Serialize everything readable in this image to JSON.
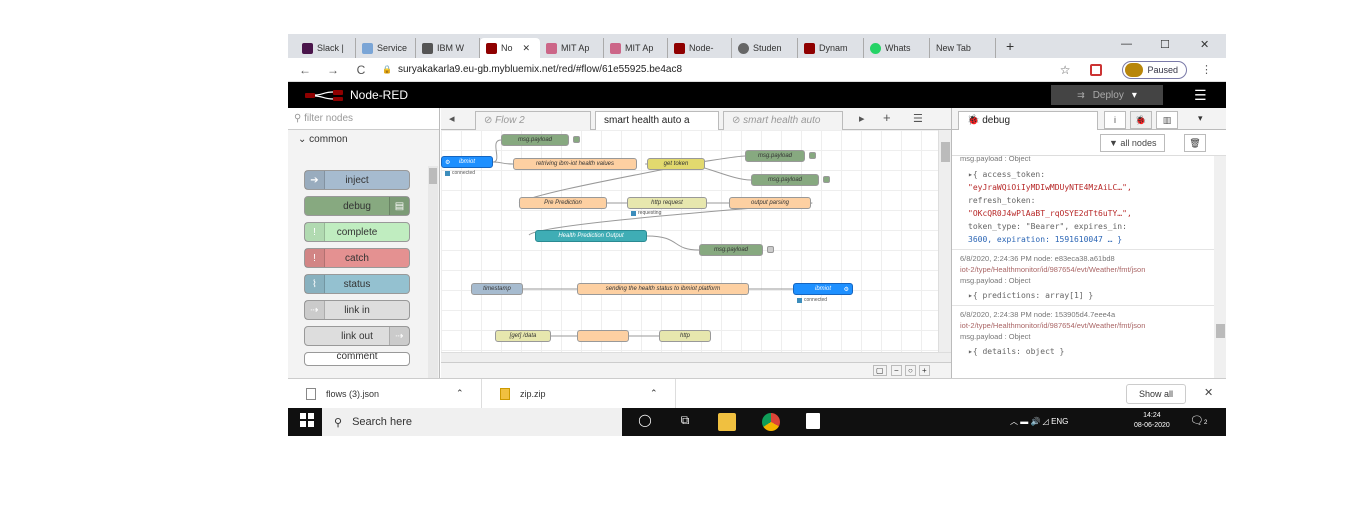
{
  "browser": {
    "tabs": [
      {
        "label": "Slack |",
        "color": "#4a154b"
      },
      {
        "label": "Service",
        "color": "#7aa5d6"
      },
      {
        "label": "IBM W",
        "color": "#555555"
      },
      {
        "label": "No",
        "color": "#8f0000",
        "active": true
      },
      {
        "label": "MIT Ap",
        "color": "#cc6688"
      },
      {
        "label": "MIT Ap",
        "color": "#cc6688"
      },
      {
        "label": "Node-",
        "color": "#8f0000"
      },
      {
        "label": "Studen",
        "color": "#666666"
      },
      {
        "label": "Dynam",
        "color": "#8f0000"
      },
      {
        "label": "Whats",
        "color": "#25d366"
      },
      {
        "label": "New Tab",
        "color": ""
      }
    ],
    "url": "suryakakarla9.eu-gb.mybluemix.net/red/#flow/61e55925.be4ac8",
    "paused_label": "Paused"
  },
  "nodered": {
    "app_title": "Node-RED",
    "deploy_label": "Deploy",
    "palette": {
      "filter_placeholder": "filter nodes",
      "category": "common",
      "nodes": [
        {
          "label": "inject",
          "color": "#a6bbcf",
          "icon": "arrow-right-icon",
          "icon_right": false
        },
        {
          "label": "debug",
          "color": "#87a980",
          "icon": "list-icon",
          "icon_right": true
        },
        {
          "label": "complete",
          "color": "#c0edc0",
          "icon": "exclamation-icon",
          "icon_right": false
        },
        {
          "label": "catch",
          "color": "#e49191",
          "icon": "exclamation-icon",
          "icon_right": false
        },
        {
          "label": "status",
          "color": "#94c1d0",
          "icon": "pulse-icon",
          "icon_right": false
        },
        {
          "label": "link in",
          "color": "#dddddd",
          "icon": "link-icon",
          "icon_right": false
        },
        {
          "label": "link out",
          "color": "#dddddd",
          "icon": "link-icon",
          "icon_right": true
        },
        {
          "label": "comment",
          "color": "#ffffff",
          "icon": "",
          "icon_right": false
        }
      ]
    },
    "workspace": {
      "tabs": [
        {
          "label": "Flow 2",
          "active": false
        },
        {
          "label": "smart health auto a",
          "active": true
        },
        {
          "label": "smart health auto",
          "active": false
        }
      ],
      "flow_nodes": {
        "msg_payload": "msg.payload",
        "retrieving": "retriving ibm-iot health values",
        "get_token": "get token",
        "pre_prediction": "Pre Prediction",
        "http_request": "http request",
        "output_parsing": "output parsing",
        "health_prediction": "Health Prediction Output",
        "timestamp": "timestamp",
        "sending": "sending the health status to ibmiot platform",
        "get_data": "[get] /data",
        "http": "http",
        "connected": "connected",
        "requesting": "requesting"
      }
    },
    "sidebar": {
      "tab_label": "debug",
      "filter_label": "all nodes",
      "messages": [
        {
          "meta": "msg.payload : Object",
          "lines": [
            "▸{ access_token:",
            "\"eyJraWQiOiIyMDIwMDUyNTE4MzAiLC…\",",
            "refresh_token:",
            "\"OKcQR0J4wPlAaBT_rqOSYE2dTt6uTY…\",",
            "token_type: \"Bearer\", expires_in:",
            "3600, expiration: 1591610047 … }"
          ]
        },
        {
          "meta": "6/8/2020, 2:24:36 PM   node: e83eca38.a61bd8",
          "topic": "iot-2/type/Healthmonitor/id/987654/evt/Weather/fmt/json",
          "type": "msg.payload : Object",
          "lines": [
            "▸{ predictions: array[1] }"
          ]
        },
        {
          "meta": "6/8/2020, 2:24:38 PM   node: 153905d4.7eee4a",
          "topic": "iot-2/type/Healthmonitor/id/987654/evt/Weather/fmt/json",
          "type": "msg.payload : Object",
          "lines": [
            "▸{ details: object }"
          ]
        }
      ]
    }
  },
  "downloads": {
    "items": [
      {
        "name": "flows (3).json"
      },
      {
        "name": "zip.zip"
      }
    ],
    "show_all": "Show all"
  },
  "taskbar": {
    "search_placeholder": "Search here",
    "lang": "ENG",
    "time": "14:24",
    "date": "08-06-2020",
    "notif_count": "2"
  }
}
